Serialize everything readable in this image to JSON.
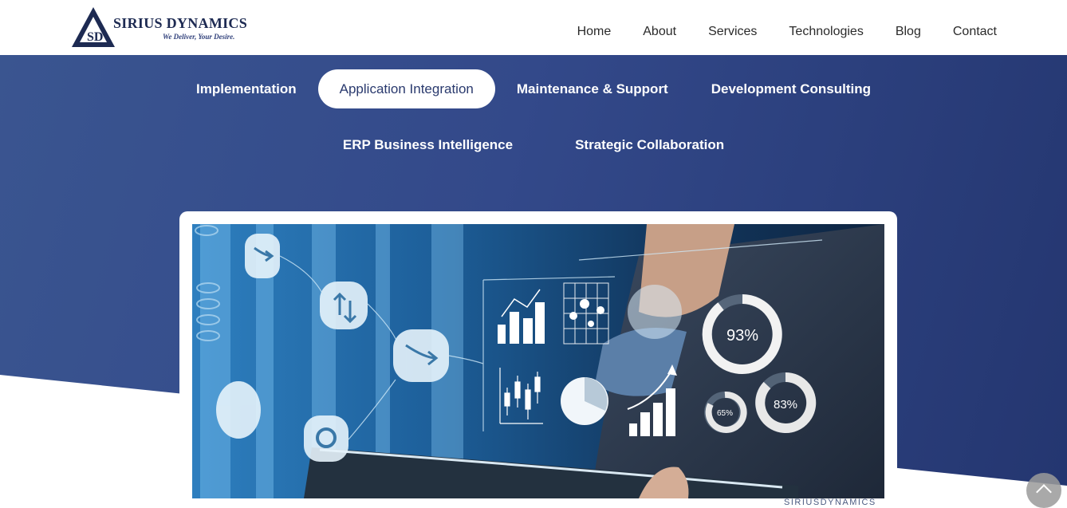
{
  "brand": {
    "name": "SIRIUS DYNAMICS",
    "tagline": "We Deliver, Your Desire.",
    "logo_letters": "SD",
    "navy": "#1d2a52"
  },
  "nav": {
    "items": [
      "Home",
      "About",
      "Services",
      "Technologies",
      "Blog",
      "Contact"
    ]
  },
  "tabs": {
    "row1": [
      "Implementation",
      "Application Integration",
      "Maintenance & Support",
      "Development Consulting"
    ],
    "row2": [
      "ERP Business Intelligence",
      "Strategic Collaboration"
    ],
    "active": "Application Integration"
  },
  "hero_image": {
    "gauge_large": "93%",
    "gauge_medium": "83%",
    "gauge_small": "65%",
    "watermark": "SIRIUSDYNAMICS"
  },
  "colors": {
    "hero_start": "#3a5590",
    "hero_end": "#243670",
    "accent_text": "#2a3a6e"
  },
  "scroll_top": {
    "icon": "chevron-up-icon"
  }
}
